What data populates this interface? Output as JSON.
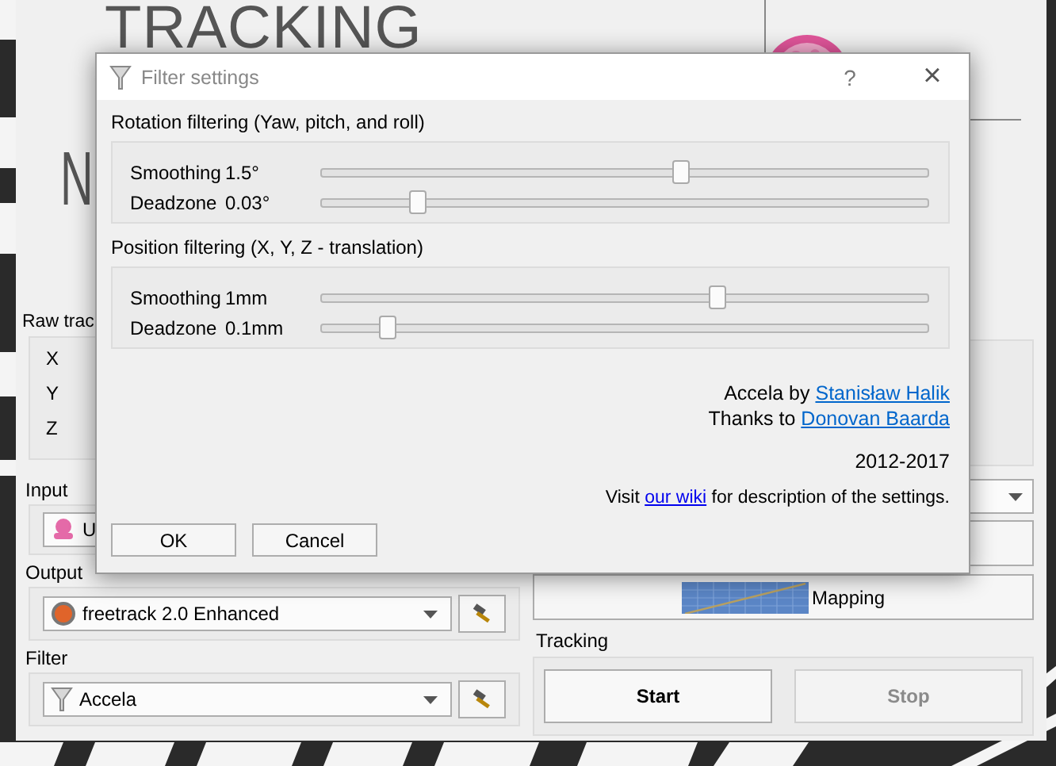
{
  "main_window": {
    "title_art": "TRACKING",
    "letter_art": "N",
    "raw_tracking": {
      "label": "Raw trac",
      "axes": [
        "X",
        "Y",
        "Z"
      ]
    },
    "input": {
      "label": "Input",
      "value": "U"
    },
    "output": {
      "label": "Output",
      "value": "freetrack 2.0 Enhanced"
    },
    "filter": {
      "label": "Filter",
      "value": "Accela"
    },
    "mapping_button": "Mapping",
    "tracking": {
      "label": "Tracking",
      "buttons": [
        {
          "label": "Start",
          "disabled": false
        },
        {
          "label": "Stop",
          "disabled": true
        }
      ]
    }
  },
  "dialog": {
    "title": "Filter settings",
    "help": "?",
    "close": "×",
    "groups": [
      {
        "title": "Rotation filtering (Yaw, pitch, and roll)",
        "sliders": [
          {
            "label": "Smoothing",
            "reading": "1.5°",
            "level": 0.59
          },
          {
            "label": "Deadzone",
            "reading": "0.03°",
            "level": 0.16
          }
        ]
      },
      {
        "title": "Position filtering (X, Y, Z - translation)",
        "sliders": [
          {
            "label": "Smoothing",
            "reading": "1mm",
            "level": 0.65
          },
          {
            "label": "Deadzone",
            "reading": "0.1mm",
            "level": 0.11
          }
        ]
      }
    ],
    "credits": [
      {
        "text": "Accela by",
        "link": "Stanisław Halik"
      },
      {
        "text": "Thanks to",
        "link": "Donovan Baarda"
      }
    ],
    "years": "2012-2017",
    "wiki": {
      "before": "Visit",
      "link": "our wiki",
      "after": "for description of the settings."
    },
    "buttons": [
      "OK",
      "Cancel"
    ]
  }
}
